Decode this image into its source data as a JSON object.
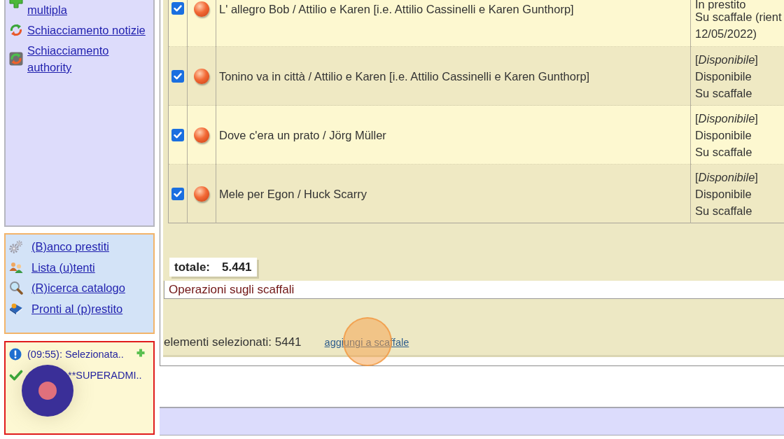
{
  "sidebar": {
    "tools_panel": {
      "items": [
        {
          "label": "multipla"
        },
        {
          "label": "Schiacciamento notizie"
        },
        {
          "label": "Schiacciamento authority"
        }
      ]
    },
    "shortcuts_panel": {
      "items": [
        {
          "label": "(B)anco prestiti"
        },
        {
          "label": "Lista (u)tenti"
        },
        {
          "label": "(R)icerca catalogo"
        },
        {
          "label": "Pronti al (p)restito"
        }
      ]
    },
    "messages_panel": {
      "messages": [
        {
          "kind": "info",
          "text": "(09:55): Selezionata..",
          "expandable": true
        },
        {
          "kind": "success",
          "text": "**SUPERADMI..",
          "expandable": false
        }
      ]
    }
  },
  "results_table": {
    "rows": [
      {
        "checked": true,
        "title": "L' allegro Bob / Attilio e Karen [i.e. Attilio Cassinelli e Karen Gunthorp]",
        "availability": [
          "In prestito",
          "Su scaffale (rient",
          "12/05/2022)"
        ]
      },
      {
        "checked": true,
        "title": "Tonino va in città / Attilio e Karen [i.e. Attilio Cassinelli e Karen Gunthorp]",
        "availability": [
          "[*Disponibile*]",
          "Disponibile",
          "Su scaffale"
        ]
      },
      {
        "checked": true,
        "title": "Dove c'era un prato / Jörg Müller",
        "availability": [
          "[*Disponibile*]",
          "Disponibile",
          "Su scaffale"
        ]
      },
      {
        "checked": true,
        "title": "Mele per Egon / Huck Scarry",
        "availability": [
          "[*Disponibile*]",
          "Disponibile",
          "Su scaffale"
        ]
      }
    ]
  },
  "total": {
    "label": "totale:",
    "value": "5.441"
  },
  "shelf_operations": {
    "title": "Operazioni sugli scaffali",
    "selected_count": "elementi selezionati: 5441",
    "action": "aggiungi a scaffale"
  }
}
